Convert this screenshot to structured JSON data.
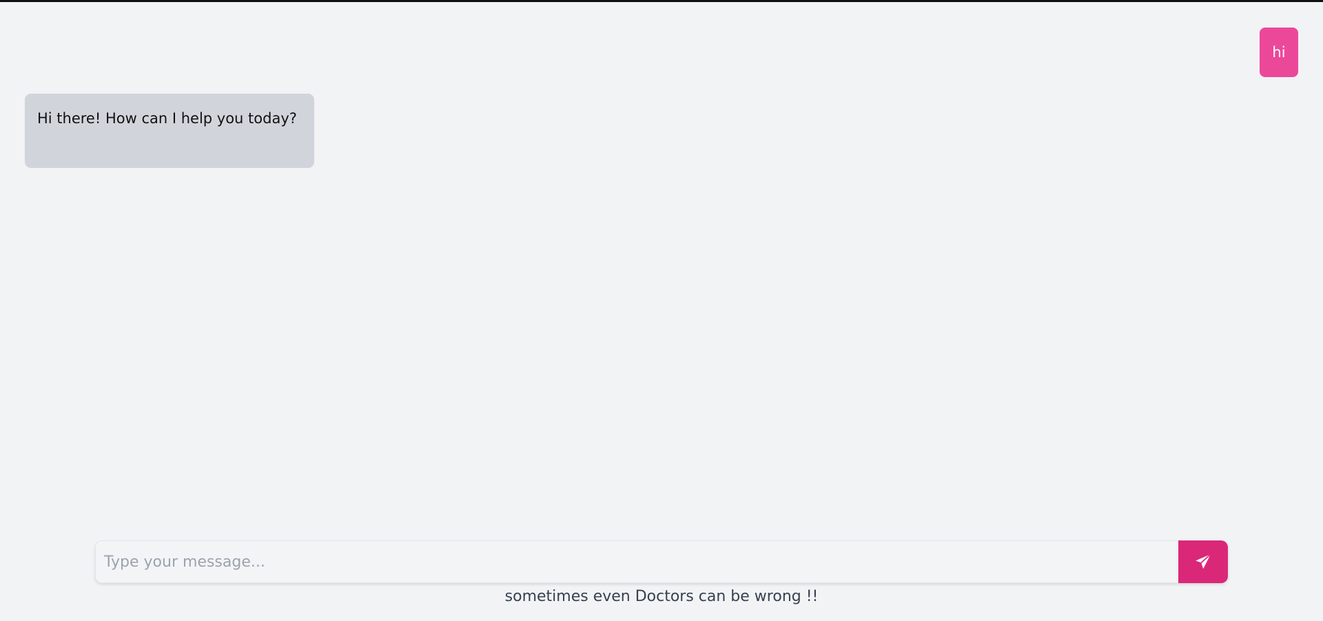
{
  "chat": {
    "messages": [
      {
        "role": "user",
        "text": "hi"
      },
      {
        "role": "assistant",
        "text": "Hi there! How can I help you today?"
      }
    ]
  },
  "composer": {
    "placeholder": "Type your message...",
    "value": "",
    "send_icon": "paper-plane-icon"
  },
  "footer": {
    "disclaimer": "sometimes even Doctors can be wrong !!"
  },
  "colors": {
    "background": "#f2f3f5",
    "user_bubble": "#ec4899",
    "assistant_bubble": "#d1d5db",
    "send_button": "#db2777"
  }
}
